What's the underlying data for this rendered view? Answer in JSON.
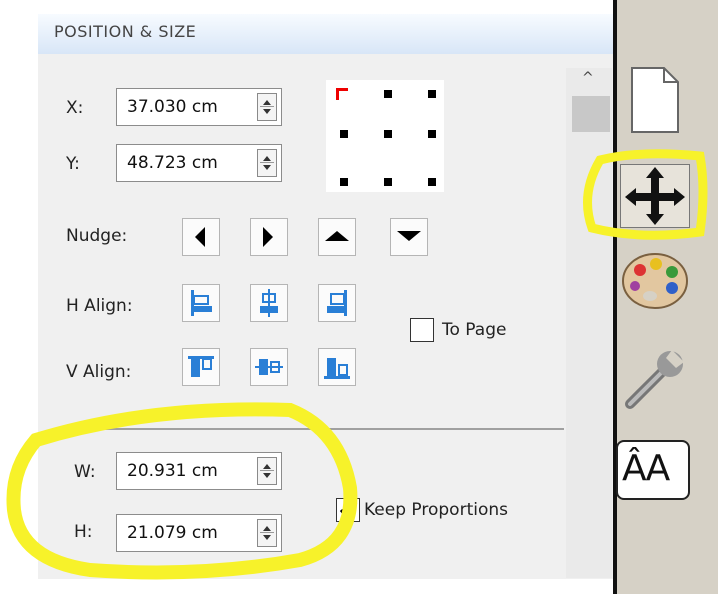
{
  "panel": {
    "title": "POSITION & SIZE",
    "x_label": "X:",
    "x_value": "37.030 cm",
    "y_label": "Y:",
    "y_value": "48.723 cm",
    "nudge_label": "Nudge:",
    "h_align_label": "H Align:",
    "v_align_label": "V Align:",
    "to_page_label": "To Page",
    "to_page_checked": false,
    "w_label": "W:",
    "w_value": "20.931 cm",
    "h_label": "H:",
    "h_value": "21.079 cm",
    "keep_proportions_label": "Keep Proportions",
    "keep_proportions_checked": true,
    "scroll_up_glyph": "^"
  },
  "sidebar": {
    "tabs": [
      "page-icon",
      "move-icon",
      "palette-icon",
      "wrench-icon",
      "text-size-icon"
    ],
    "text_size_glyph": "ÂA"
  },
  "colors": {
    "highlight": "#f7f22a",
    "header_blue": "#d8e6f7",
    "sidebar_bg": "#d6d1c6",
    "align_blue": "#2a7fd6"
  }
}
